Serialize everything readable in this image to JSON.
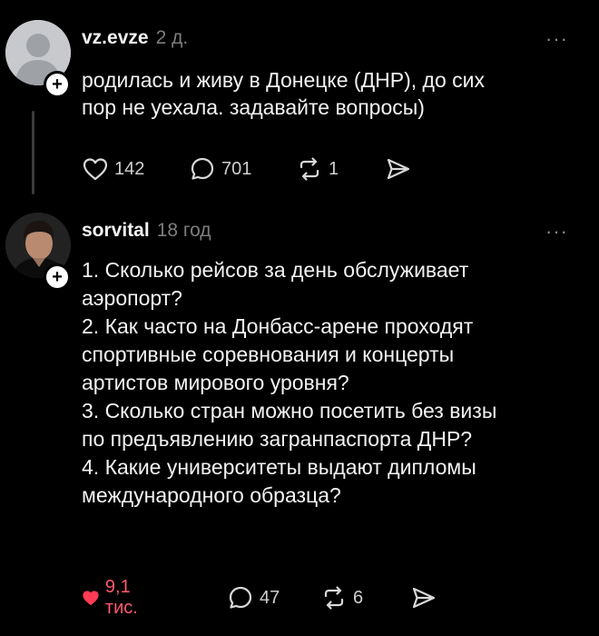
{
  "posts": [
    {
      "username": "vz.evze",
      "time": "2 д.",
      "more": "···",
      "follow": "+",
      "lines": [
        "родилась и живу в Донецке (ДНР), до сих",
        "пор не уехала. задавайте вопросы)"
      ],
      "actions": {
        "likes": "142",
        "comments": "701",
        "reposts": "1"
      },
      "liked": false
    },
    {
      "username": "sorvital",
      "time": "18 год",
      "more": "···",
      "follow": "+",
      "lines": [
        "1. Сколько рейсов за день обслуживает",
        "аэропорт?",
        "2. Как часто на Донбасс-арене проходят",
        "спортивные соревнования и концерты",
        "артистов мирового уровня?",
        "3. Сколько стран можно посетить без визы",
        "по предъявлению загранпаспорта ДНР?",
        "4. Какие университеты выдают дипломы",
        "международного образца?"
      ],
      "actions": {
        "likes": "9,1 тис.",
        "comments": "47",
        "reposts": "6"
      },
      "liked": true
    }
  ],
  "icons": [
    "heart-icon",
    "comment-icon",
    "repost-icon",
    "share-icon",
    "more-icon"
  ],
  "colors": {
    "background": "#000000",
    "like_active": "#ff3b55",
    "muted": "#7d7d7d"
  }
}
